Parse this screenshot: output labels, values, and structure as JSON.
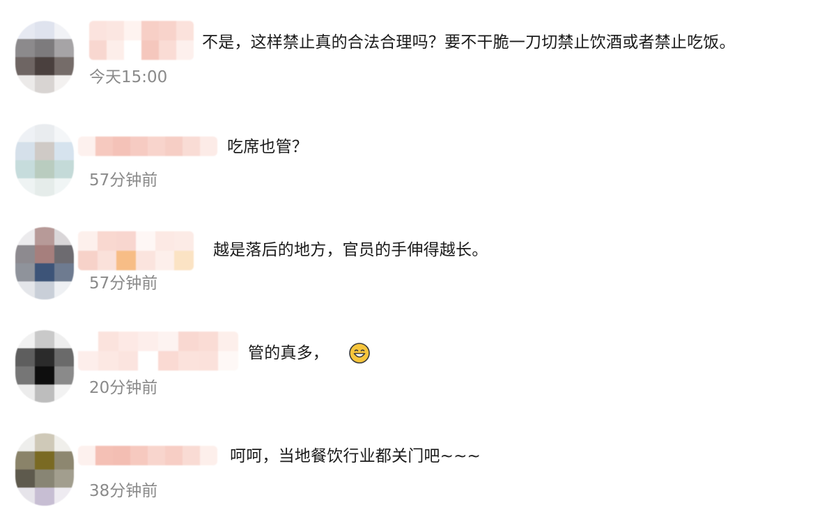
{
  "comments": [
    {
      "text": "不是，这样禁止真的合法合理吗？要不干脆一刀切禁止饮酒或者禁止吃饭。",
      "time": "今天15:00"
    },
    {
      "text": "吃席也管？",
      "time": "57分钟前"
    },
    {
      "text": "越是落后的地方，官员的手伸得越长。",
      "time": "57分钟前"
    },
    {
      "text": "管的真多，",
      "emoji": "grinning-face-icon",
      "time": "20分钟前"
    },
    {
      "text": "呵呵，当地餐饮行业都关门吧~~~",
      "time": "38分钟前"
    }
  ],
  "colors": {
    "text": "#1b1b1b",
    "timestamp": "#8a8a8a",
    "username_blur": "#f4c4bc",
    "background": "#ffffff"
  }
}
